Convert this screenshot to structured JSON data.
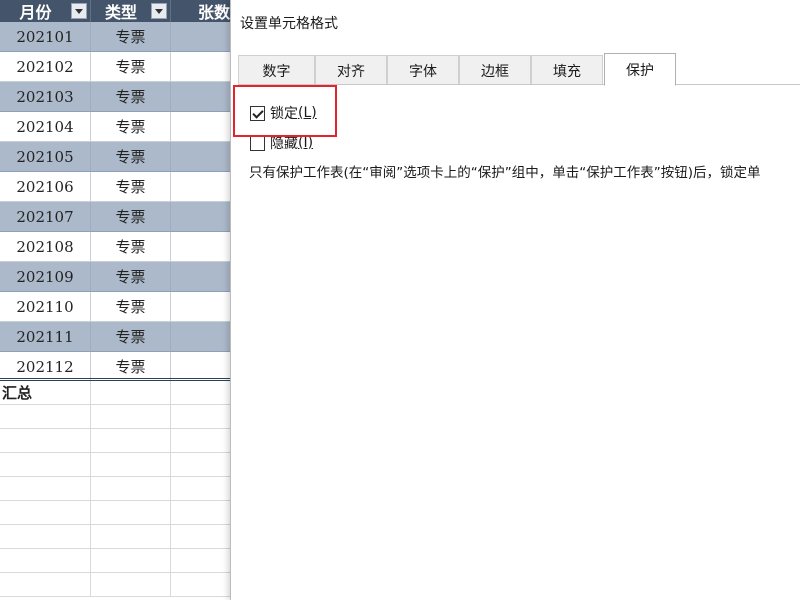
{
  "sheet": {
    "headers": [
      "月份",
      "类型",
      "张数"
    ],
    "rows": [
      {
        "month": "202101",
        "type": "专票"
      },
      {
        "month": "202102",
        "type": "专票"
      },
      {
        "month": "202103",
        "type": "专票"
      },
      {
        "month": "202104",
        "type": "专票"
      },
      {
        "month": "202105",
        "type": "专票"
      },
      {
        "month": "202106",
        "type": "专票"
      },
      {
        "month": "202107",
        "type": "专票"
      },
      {
        "month": "202108",
        "type": "专票"
      },
      {
        "month": "202109",
        "type": "专票"
      },
      {
        "month": "202110",
        "type": "专票"
      },
      {
        "month": "202111",
        "type": "专票"
      },
      {
        "month": "202112",
        "type": "专票"
      }
    ],
    "summary_label": "汇总",
    "colors": {
      "header": "#44546a",
      "band": "#acb9ca"
    }
  },
  "dialog": {
    "title": "设置单元格格式",
    "tabs": [
      "数字",
      "对齐",
      "字体",
      "边框",
      "填充",
      "保护"
    ],
    "active_tab": "保护",
    "locked": {
      "label": "锁定",
      "key": "(L)",
      "checked": true
    },
    "hidden": {
      "label": "隐藏",
      "key": "(I)",
      "checked": false
    },
    "info_text": "只有保护工作表(在“审阅”选项卡上的“保护”组中，单击“保护工作表”按钮)后，锁定单",
    "highlight_color": "#e0252d"
  }
}
